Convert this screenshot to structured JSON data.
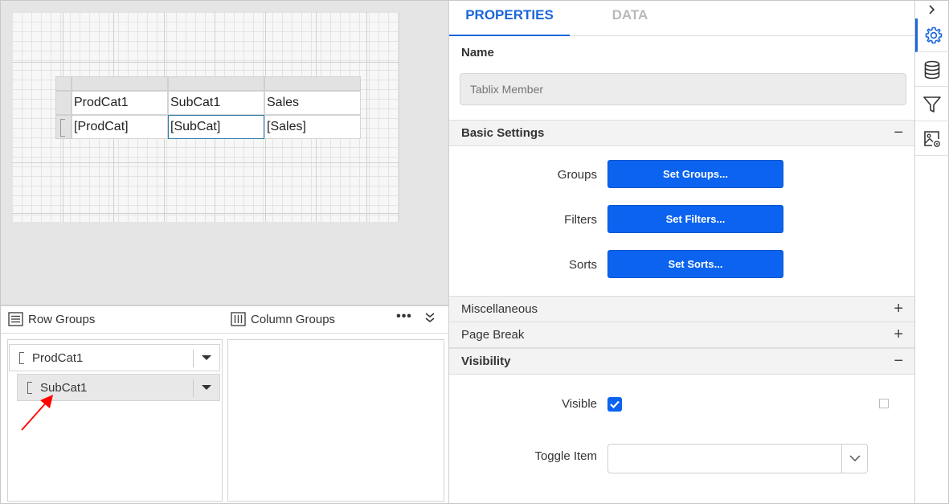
{
  "design": {
    "table": {
      "header": [
        "ProdCat1",
        "SubCat1",
        "Sales"
      ],
      "detail": [
        "[ProdCat]",
        "[SubCat]",
        "[Sales]"
      ]
    }
  },
  "groups": {
    "row_groups_label": "Row Groups",
    "column_groups_label": "Column Groups",
    "more_label": "•••",
    "row_items": [
      {
        "label": "ProdCat1"
      },
      {
        "label": "SubCat1"
      }
    ]
  },
  "properties": {
    "tabs": [
      {
        "label": "PROPERTIES",
        "active": true
      },
      {
        "label": "DATA",
        "active": false
      }
    ],
    "name_label": "Name",
    "name_placeholder": "Tablix Member",
    "sections": {
      "basic_settings": {
        "title": "Basic Settings",
        "toggle": "−"
      },
      "miscellaneous": {
        "title": "Miscellaneous",
        "toggle": "+"
      },
      "page_break": {
        "title": "Page Break",
        "toggle": "+"
      },
      "visibility": {
        "title": "Visibility",
        "toggle": "−"
      }
    },
    "basic": {
      "groups_label": "Groups",
      "groups_button": "Set Groups...",
      "filters_label": "Filters",
      "filters_button": "Set Filters...",
      "sorts_label": "Sorts",
      "sorts_button": "Set Sorts..."
    },
    "visibility": {
      "visible_label": "Visible",
      "visible_checked": true,
      "toggle_item_label": "Toggle Item",
      "toggle_item_value": ""
    }
  },
  "toolbar": {
    "items": [
      {
        "icon": "chevron-right-icon"
      },
      {
        "icon": "gear-icon",
        "active": true
      },
      {
        "icon": "database-icon"
      },
      {
        "icon": "filter-icon"
      },
      {
        "icon": "image-settings-icon"
      }
    ]
  },
  "colors": {
    "accent": "#1a66d8",
    "button": "#0b63f0",
    "annotation_arrow": "#ff0000"
  }
}
